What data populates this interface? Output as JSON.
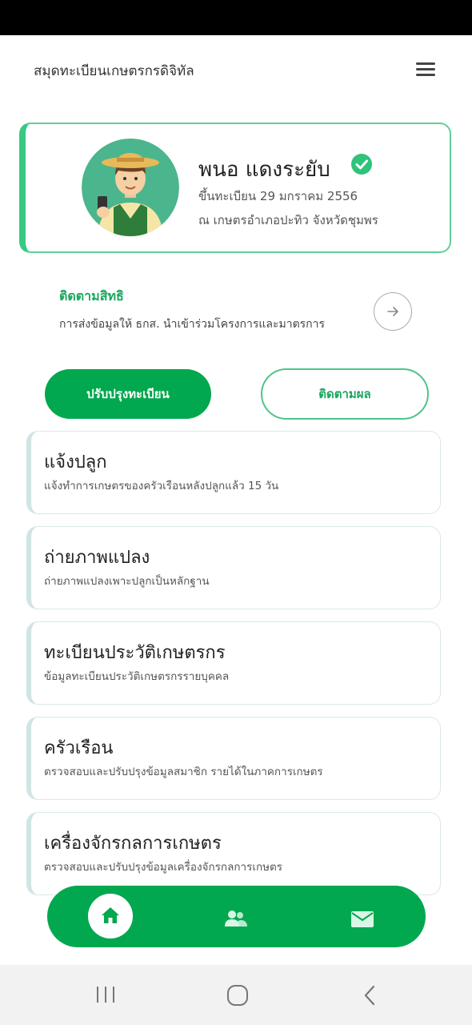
{
  "header": {
    "title": "สมุดทะเบียนเกษตรกรดิจิทัล"
  },
  "profile": {
    "name": "พนอ แดงระยับ",
    "registered": "ขึ้นทะเบียน 29 มกราคม 2556",
    "office": "ณ เกษตรอำเภอปะทิว จังหวัดชุมพร"
  },
  "tracking": {
    "title": "ติดตามสิทธิ",
    "description": "การส่งข้อมูลให้ ธกส. นำเข้าร่วมโครงการและมาตรการ"
  },
  "actions": {
    "update_label": "ปรับปรุงทะเบียน",
    "follow_label": "ติดตามผล"
  },
  "menu_cards": [
    {
      "title": "แจ้งปลูก",
      "desc": "แจ้งทำการเกษตรของครัวเรือนหลังปลูกแล้ว 15 วัน"
    },
    {
      "title": "ถ่ายภาพแปลง",
      "desc": "ถ่ายภาพแปลงเพาะปลูกเป็นหลักฐาน"
    },
    {
      "title": "ทะเบียนประวัติเกษตรกร",
      "desc": "ข้อมูลทะเบียนประวัติเกษตรกรรายบุคคล"
    },
    {
      "title": "ครัวเรือน",
      "desc": "ตรวจสอบและปรับปรุงข้อมูลสมาชิก รายได้ในภาคการเกษตร"
    },
    {
      "title": "เครื่องจักรกลการเกษตร",
      "desc": "ตรวจสอบและปรับปรุงข้อมูลเครื่องจักรกลการเกษตร"
    }
  ],
  "bottom_nav": {
    "items": [
      {
        "icon": "home-icon",
        "active": true
      },
      {
        "icon": "users-icon",
        "active": false
      },
      {
        "icon": "mail-icon",
        "active": false
      }
    ]
  },
  "colors": {
    "primary": "#02a84f",
    "accent_text": "#1aa65f",
    "card_border": "#5fcf9a"
  }
}
